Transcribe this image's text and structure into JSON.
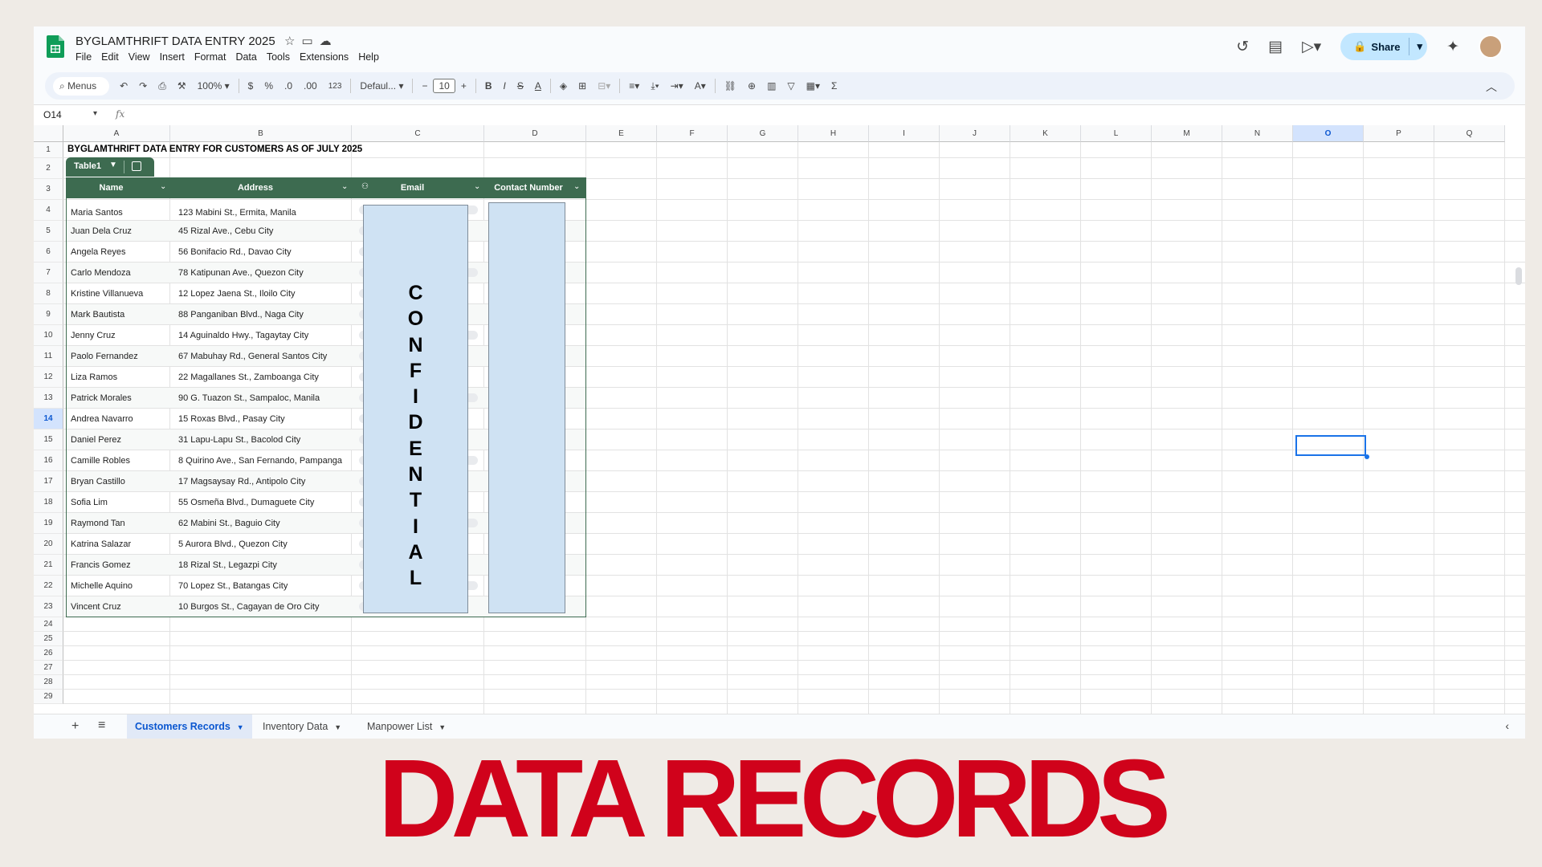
{
  "app": {
    "title": "BYGLAMTHRIFT DATA ENTRY 2025",
    "menus": [
      "File",
      "Edit",
      "View",
      "Insert",
      "Format",
      "Data",
      "Tools",
      "Extensions",
      "Help"
    ],
    "share_label": "Share",
    "accent": "#3d6b50",
    "brand_red": "#d0021b"
  },
  "toolbar": {
    "menus_search": "Menus",
    "zoom": "100%",
    "currency": "$",
    "percent": "%",
    "dec_decrease": ".0",
    "dec_increase": ".00",
    "number_format": "123",
    "font": "Defaul...",
    "font_size": "10",
    "bold": "B",
    "italic": "I",
    "strike": "S",
    "text_color": "A",
    "sum": "Σ"
  },
  "formula_bar": {
    "cell_ref": "O14",
    "fx": "fx"
  },
  "grid": {
    "columns": [
      "A",
      "B",
      "C",
      "D",
      "E",
      "F",
      "G",
      "H",
      "I",
      "J",
      "K",
      "L",
      "M",
      "N",
      "O",
      "P",
      "Q"
    ],
    "selected_column": "O",
    "rows": [
      "1",
      "2",
      "3",
      "4",
      "5",
      "6",
      "7",
      "8",
      "9",
      "10",
      "11",
      "12",
      "13",
      "14",
      "15",
      "16",
      "17",
      "18",
      "19",
      "20",
      "21",
      "22",
      "23",
      "24",
      "25",
      "26",
      "27",
      "28",
      "29"
    ],
    "selected_row": "14"
  },
  "sheet": {
    "title": "BYGLAMTHRIFT DATA ENTRY FOR CUSTOMERS  AS OF JULY 2025",
    "table_name": "Table1",
    "headers": [
      "Name",
      "Address",
      "Email",
      "Contact Number"
    ],
    "records": [
      {
        "name": "Maria Santos",
        "address": "123 Mabini St., Ermita, Manila"
      },
      {
        "name": "Juan Dela Cruz",
        "address": "45 Rizal Ave., Cebu City"
      },
      {
        "name": "Angela Reyes",
        "address": "56 Bonifacio Rd., Davao City"
      },
      {
        "name": "Carlo Mendoza",
        "address": "78 Katipunan Ave., Quezon City"
      },
      {
        "name": "Kristine Villanueva",
        "address": "12 Lopez Jaena St., Iloilo City"
      },
      {
        "name": "Mark Bautista",
        "address": "88 Panganiban Blvd., Naga City"
      },
      {
        "name": "Jenny Cruz",
        "address": "14 Aguinaldo Hwy., Tagaytay City"
      },
      {
        "name": "Paolo Fernandez",
        "address": "67 Mabuhay Rd., General Santos City"
      },
      {
        "name": "Liza Ramos",
        "address": "22 Magallanes St., Zamboanga City"
      },
      {
        "name": "Patrick Morales",
        "address": "90 G. Tuazon St., Sampaloc, Manila"
      },
      {
        "name": "Andrea Navarro",
        "address": "15 Roxas Blvd., Pasay City"
      },
      {
        "name": "Daniel Perez",
        "address": "31 Lapu-Lapu St., Bacolod City"
      },
      {
        "name": "Camille Robles",
        "address": "8 Quirino Ave., San Fernando, Pampanga"
      },
      {
        "name": "Bryan Castillo",
        "address": "17 Magsaysay Rd., Antipolo City"
      },
      {
        "name": "Sofia Lim",
        "address": "55 Osmeña Blvd., Dumaguete City"
      },
      {
        "name": "Raymond Tan",
        "address": "62 Mabini St., Baguio City"
      },
      {
        "name": "Katrina Salazar",
        "address": "5 Aurora Blvd., Quezon City"
      },
      {
        "name": "Francis Gomez",
        "address": "18 Rizal St., Legazpi City"
      },
      {
        "name": "Michelle Aquino",
        "address": "70 Lopez St., Batangas City"
      },
      {
        "name": "Vincent Cruz",
        "address": "10 Burgos St., Cagayan de Oro City"
      }
    ],
    "confidential_letters": [
      "C",
      "O",
      "N",
      "F",
      "I",
      "D",
      "E",
      "N",
      "T",
      "I",
      "A",
      "L"
    ]
  },
  "tabs": [
    {
      "label": "Customers Records",
      "active": true
    },
    {
      "label": "Inventory Data",
      "active": false
    },
    {
      "label": "Manpower List",
      "active": false
    }
  ],
  "banner": {
    "text": "DATA RECORDS"
  }
}
